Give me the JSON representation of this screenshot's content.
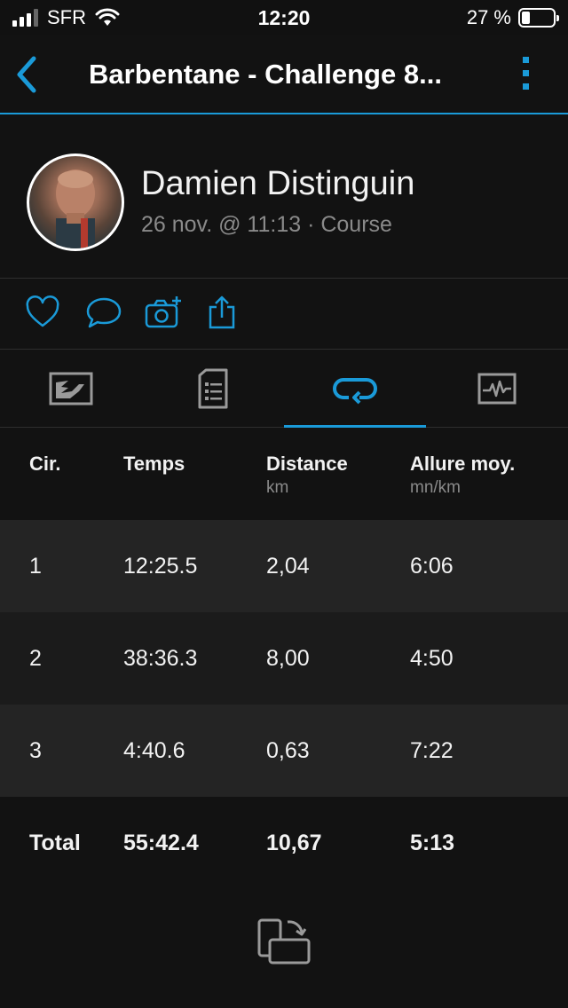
{
  "status_bar": {
    "carrier": "SFR",
    "time": "12:20",
    "battery": "27 %",
    "battery_level": 0.27
  },
  "nav": {
    "title": "Barbentane - Challenge 8..."
  },
  "profile": {
    "name": "Damien Distinguin",
    "meta": "26 nov. @ 11:13 · Course"
  },
  "tabs": [
    {
      "icon": "map-icon",
      "active": false
    },
    {
      "icon": "document-list-icon",
      "active": false
    },
    {
      "icon": "laps-loop-icon",
      "active": true
    },
    {
      "icon": "activity-chart-icon",
      "active": false
    }
  ],
  "table": {
    "headers": [
      {
        "label": "Cir.",
        "unit": ""
      },
      {
        "label": "Temps",
        "unit": ""
      },
      {
        "label": "Distance",
        "unit": "km"
      },
      {
        "label": "Allure moy.",
        "unit": "mn/km"
      }
    ],
    "rows": [
      [
        "1",
        "12:25.5",
        "2,04",
        "6:06"
      ],
      [
        "2",
        "38:36.3",
        "8,00",
        "4:50"
      ],
      [
        "3",
        "4:40.6",
        "0,63",
        "7:22"
      ]
    ],
    "total": [
      "Total",
      "55:42.4",
      "10,67",
      "5:13"
    ]
  },
  "colors": {
    "accent": "#1a9ad8",
    "background": "#121212",
    "row_odd": "#242424",
    "row_even": "#1b1b1b"
  }
}
